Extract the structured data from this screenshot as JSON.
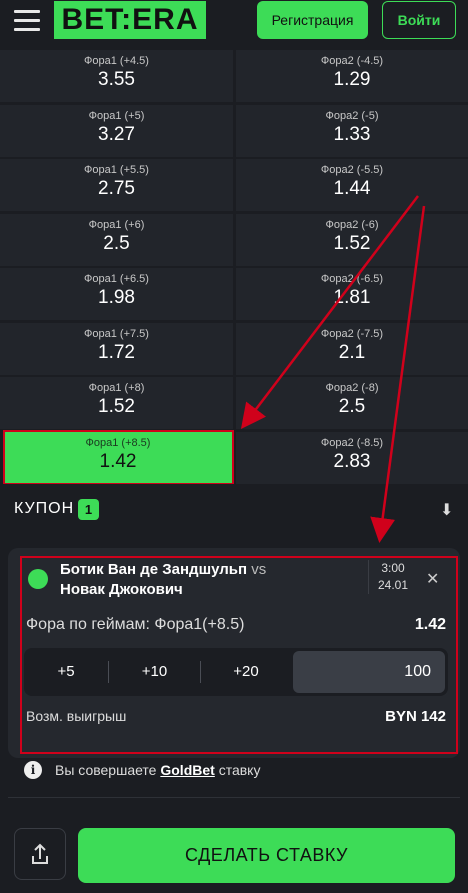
{
  "header": {
    "logo_text": "BET:ERA",
    "register_label": "Регистрация",
    "login_label": "Войти"
  },
  "odds": [
    {
      "left_label": "Фора1 (+4.5)",
      "left_odd": "3.55",
      "right_label": "Фора2 (-4.5)",
      "right_odd": "1.29"
    },
    {
      "left_label": "Фора1 (+5)",
      "left_odd": "3.27",
      "right_label": "Фора2 (-5)",
      "right_odd": "1.33"
    },
    {
      "left_label": "Фора1 (+5.5)",
      "left_odd": "2.75",
      "right_label": "Фора2 (-5.5)",
      "right_odd": "1.44"
    },
    {
      "left_label": "Фора1 (+6)",
      "left_odd": "2.5",
      "right_label": "Фора2 (-6)",
      "right_odd": "1.52"
    },
    {
      "left_label": "Фора1 (+6.5)",
      "left_odd": "1.98",
      "right_label": "Фора2 (-6.5)",
      "right_odd": "1.81"
    },
    {
      "left_label": "Фора1 (+7.5)",
      "left_odd": "1.72",
      "right_label": "Фора2 (-7.5)",
      "right_odd": "2.1"
    },
    {
      "left_label": "Фора1 (+8)",
      "left_odd": "1.52",
      "right_label": "Фора2 (-8)",
      "right_odd": "2.5"
    },
    {
      "left_label": "Фора1 (+8.5)",
      "left_odd": "1.42",
      "right_label": "Фора2 (-8.5)",
      "right_odd": "2.83"
    }
  ],
  "coupon": {
    "title": "КУПОН",
    "count": "1",
    "team1": "Ботик Ван де Зандшульп",
    "vs": "vs",
    "team2": "Новак Джокович",
    "time": "3:00",
    "date": "24.01",
    "market": "Фора по геймам: Фора1(+8.5)",
    "odd": "1.42",
    "quick_stakes": [
      "+5",
      "+10",
      "+20"
    ],
    "amount": "100",
    "win_label": "Возм. выигрыш",
    "win_value": "BYN 142"
  },
  "info": {
    "prefix": "Вы совершаете",
    "link": "GoldBet",
    "suffix": "ставку"
  },
  "footer": {
    "place_bet_label": "СДЕЛАТЬ СТАВКУ"
  },
  "colors": {
    "accent": "#3ddc57",
    "background": "#1b1d22",
    "annotation": "#d0011b"
  }
}
